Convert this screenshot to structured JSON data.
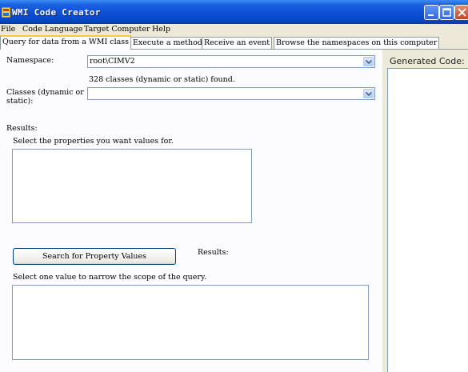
{
  "window": {
    "title": "WMI Code Creator"
  },
  "menu": {
    "items": [
      "File",
      "Code Language",
      "Target Computer",
      "Help"
    ]
  },
  "tabs": [
    {
      "label": "Query for data from a WMI class",
      "selected": true
    },
    {
      "label": "Execute a method"
    },
    {
      "label": "Receive an event"
    },
    {
      "label": "Browse the namespaces on this computer"
    }
  ],
  "query": {
    "namespace_label": "Namespace:",
    "namespace_value": "root\\CIMV2",
    "classes_found": "328 classes (dynamic or static) found.",
    "classes_label_line1": "Classes (dynamic or",
    "classes_label_line2": "static):",
    "classes_value": "",
    "results_label": "Results:",
    "select_properties_text": "Select the properties you want values for.",
    "search_button": "Search for Property Values",
    "results_label_2": "Results:",
    "narrow_scope_text": "Select one value to narrow the scope of the query."
  },
  "code_panel": {
    "label": "Generated Code:"
  },
  "colors": {
    "title_bar": "#0b4fd9",
    "tab_highlight": "#ffc83c",
    "panel_bg": "#ece9d8",
    "field_border": "#7f9db9"
  }
}
